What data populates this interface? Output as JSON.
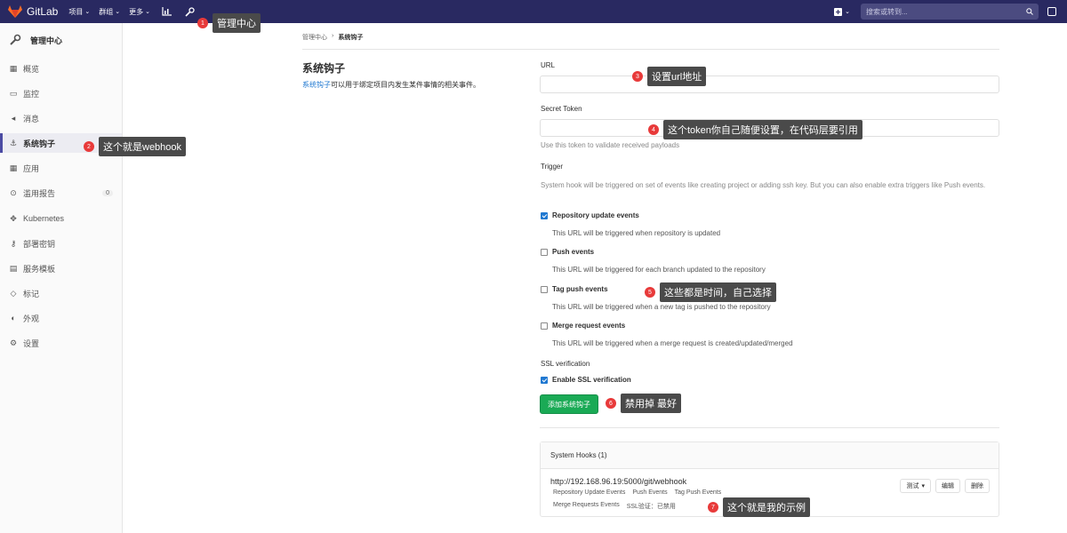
{
  "topbar": {
    "brand": "GitLab",
    "nav": [
      {
        "label": "项目"
      },
      {
        "label": "群组"
      },
      {
        "label": "更多"
      }
    ],
    "search_placeholder": "搜索或转到..."
  },
  "sidebar": {
    "header": "管理中心",
    "items": [
      {
        "label": "概览",
        "icon": "overview-icon"
      },
      {
        "label": "监控",
        "icon": "monitor-icon"
      },
      {
        "label": "消息",
        "icon": "messages-icon"
      },
      {
        "label": "系统钩子",
        "icon": "hook-icon",
        "active": true
      },
      {
        "label": "应用",
        "icon": "apps-icon"
      },
      {
        "label": "滥用报告",
        "icon": "abuse-icon",
        "badge": "0"
      },
      {
        "label": "Kubernetes",
        "icon": "kubernetes-icon"
      },
      {
        "label": "部署密钥",
        "icon": "key-icon"
      },
      {
        "label": "服务模板",
        "icon": "template-icon"
      },
      {
        "label": "标记",
        "icon": "label-icon"
      },
      {
        "label": "外观",
        "icon": "appearance-icon"
      },
      {
        "label": "设置",
        "icon": "settings-icon"
      }
    ]
  },
  "breadcrumb": {
    "parent": "管理中心",
    "separator": "›",
    "current": "系统钩子"
  },
  "section": {
    "title": "系统钩子",
    "desc_link": "系统钩子",
    "desc_rest": "可以用于绑定项目内发生某件事情的相关事件。"
  },
  "form": {
    "url_label": "URL",
    "token_label": "Secret Token",
    "token_help": "Use this token to validate received payloads",
    "trigger_label": "Trigger",
    "trigger_help": "System hook will be triggered on set of events like creating project or adding ssh key. But you can also enable extra triggers like Push events.",
    "triggers": [
      {
        "label": "Repository update events",
        "desc": "This URL will be triggered when repository is updated",
        "checked": true
      },
      {
        "label": "Push events",
        "desc": "This URL will be triggered for each branch updated to the repository",
        "checked": false
      },
      {
        "label": "Tag push events",
        "desc": "This URL will be triggered when a new tag is pushed to the repository",
        "checked": false
      },
      {
        "label": "Merge request events",
        "desc": "This URL will be triggered when a merge request is created/updated/merged",
        "checked": false
      }
    ],
    "ssl_label": "SSL verification",
    "ssl_option": "Enable SSL verification",
    "ssl_checked": true,
    "submit": "添加系统钩子"
  },
  "hooks": {
    "title": "System Hooks (1)",
    "items": [
      {
        "url": "http://192.168.96.19:5000/git/webhook",
        "tags_line1": [
          "Repository Update Events",
          "Push Events",
          "Tag Push Events"
        ],
        "tags_line2": [
          "Merge Requests Events",
          "SSL验证：已禁用"
        ],
        "test": "测试",
        "edit": "编辑",
        "delete": "删除"
      }
    ]
  },
  "annotations": [
    {
      "num": "1",
      "text": "管理中心"
    },
    {
      "num": "2",
      "text": "这个就是webhook"
    },
    {
      "num": "3",
      "text": "设置url地址"
    },
    {
      "num": "4",
      "text": "这个token你自己随便设置，在代码层要引用"
    },
    {
      "num": "5",
      "text": "这些都是时间，自己选择"
    },
    {
      "num": "6",
      "text": "禁用掉 最好"
    },
    {
      "num": "7",
      "text": "这个就是我的示例"
    }
  ],
  "colors": {
    "topbar": "#292961",
    "accent": "#1f78d1",
    "success": "#1aaa55",
    "annotation": "#e83a3a"
  }
}
